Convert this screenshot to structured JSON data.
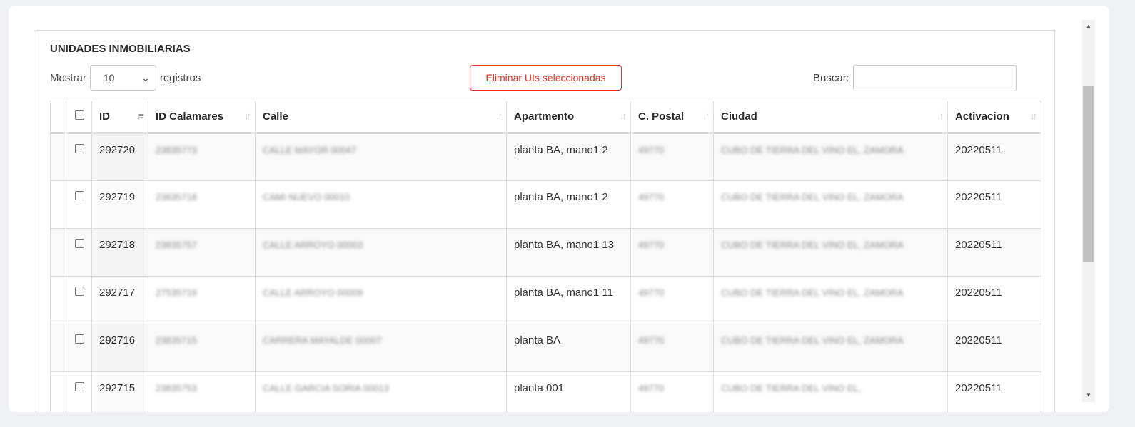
{
  "title": "UNIDADES INMOBILIARIAS",
  "length": {
    "prefix": "Mostrar",
    "value": "10",
    "suffix": "registros"
  },
  "delete_button": "Eliminar UIs seleccionadas",
  "search": {
    "label": "Buscar:",
    "value": "",
    "placeholder": ""
  },
  "columns": [
    "ID",
    "ID Calamares",
    "Calle",
    "Apartmento",
    "C. Postal",
    "Ciudad",
    "Activacion"
  ],
  "rows": [
    {
      "id": "292720",
      "calamares": "23835773",
      "calle": "CALLE MAYOR 00047",
      "apt": "planta BA, mano1 2",
      "cp": "49770",
      "ciudad": "CUBO DE TIERRA DEL VINO EL, ZAMORA",
      "act": "20220511"
    },
    {
      "id": "292719",
      "calamares": "23835718",
      "calle": "CAMI NUEVO 00010",
      "apt": "planta BA, mano1 2",
      "cp": "49770",
      "ciudad": "CUBO DE TIERRA DEL VINO EL, ZAMORA",
      "act": "20220511"
    },
    {
      "id": "292718",
      "calamares": "23835757",
      "calle": "CALLE ARROYO 00003",
      "apt": "planta BA, mano1 13",
      "cp": "49770",
      "ciudad": "CUBO DE TIERRA DEL VINO EL, ZAMORA",
      "act": "20220511"
    },
    {
      "id": "292717",
      "calamares": "27535719",
      "calle": "CALLE ARROYO 00009",
      "apt": "planta BA, mano1 11",
      "cp": "49770",
      "ciudad": "CUBO DE TIERRA DEL VINO EL, ZAMORA",
      "act": "20220511"
    },
    {
      "id": "292716",
      "calamares": "23835715",
      "calle": "CARRERA MAYALDE 00007",
      "apt": "planta BA",
      "cp": "49770",
      "ciudad": "CUBO DE TIERRA DEL VINO EL, ZAMORA",
      "act": "20220511"
    },
    {
      "id": "292715",
      "calamares": "23835753",
      "calle": "CALLE GARCIA SORIA 00013",
      "apt": "planta 001",
      "cp": "49770",
      "ciudad": "CUBO DE TIERRA DEL VINO EL,",
      "act": "20220511"
    }
  ]
}
